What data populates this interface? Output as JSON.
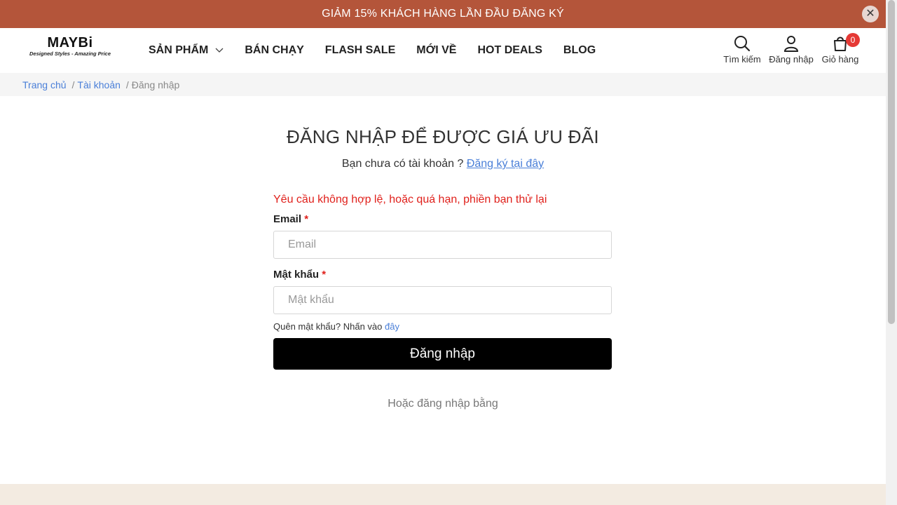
{
  "promo": {
    "text": "GIẢM 15% KHÁCH HÀNG LẦN ĐẦU ĐĂNG KÝ",
    "close_symbol": "✕"
  },
  "header": {
    "logo": {
      "main": "MAYBi",
      "tagline": "Designed Styles - Amazing Price"
    },
    "nav": [
      {
        "label": "SẢN PHẨM",
        "has_dropdown": true
      },
      {
        "label": "BÁN CHẠY"
      },
      {
        "label": "FLASH SALE"
      },
      {
        "label": "MỚI VỀ"
      },
      {
        "label": "HOT DEALS"
      },
      {
        "label": "BLOG"
      }
    ],
    "actions": {
      "search": {
        "label": "Tìm kiếm",
        "icon": "search-icon"
      },
      "login": {
        "label": "Đăng nhập",
        "icon": "user-icon"
      },
      "cart": {
        "label": "Giỏ hàng",
        "icon": "cart-icon",
        "count": "0"
      }
    }
  },
  "breadcrumb": {
    "home": "Trang chủ",
    "account": "Tài khoản",
    "current": "Đăng nhập",
    "separator": "/"
  },
  "main": {
    "title": "ĐĂNG NHẬP ĐỂ ĐƯỢC GIÁ ƯU ĐÃI",
    "subtitle_prefix": "Bạn chưa có tài khoản ?",
    "register_link": "Đăng ký tại đây",
    "error": "Yêu cầu không hợp lệ, hoặc quá hạn, phiền bạn thử lại",
    "email_label": "Email",
    "email_placeholder": "Email",
    "email_value": "",
    "password_label": "Mật khẩu",
    "password_placeholder": "Mật khẩu",
    "password_value": "",
    "required_mark": "*",
    "forgot_prefix": "Quên mật khẩu? Nhấn vào",
    "forgot_link": "đây",
    "submit_label": "Đăng nhập",
    "or_text": "Hoặc đăng nhập bằng"
  },
  "colors": {
    "promo_bg": "#b4553a",
    "link": "#4a7fd8",
    "error": "#e0201b",
    "button_bg": "#000000",
    "badge": "#e53935",
    "footer_bg": "#f3ebe1"
  }
}
